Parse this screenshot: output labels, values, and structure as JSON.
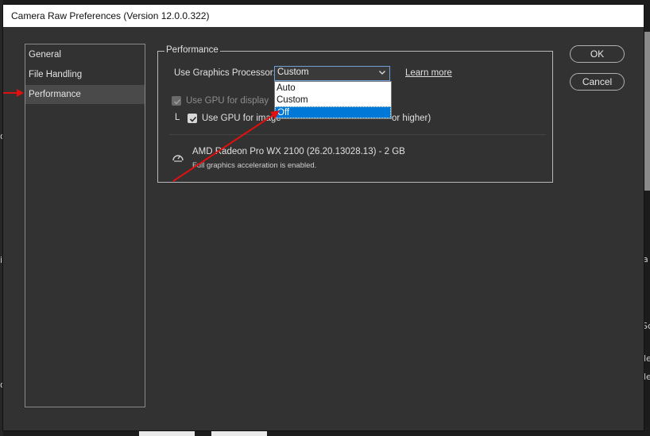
{
  "dialog": {
    "title": "Camera Raw Preferences  (Version 12.0.0.322)"
  },
  "sidebar": {
    "items": [
      {
        "label": "General"
      },
      {
        "label": "File Handling"
      },
      {
        "label": "Performance"
      }
    ]
  },
  "performance": {
    "group_title": "Performance",
    "gpu_label": "Use Graphics Processor:",
    "gpu_selected": "Custom",
    "gpu_options": [
      "Auto",
      "Custom",
      "Off"
    ],
    "gpu_highlighted": "Off",
    "learn_more": "Learn more",
    "display_label": "Use GPU for display",
    "image_label": "Use GPU for image",
    "image_label_suffix": "or higher)",
    "tree_marker": "L",
    "gpu_name": "AMD Radeon Pro WX 2100 (26.20.13028.13) - 2 GB",
    "gpu_status": "Full graphics acceleration is enabled."
  },
  "buttons": {
    "ok": "OK",
    "cancel": "Cancel"
  },
  "background": {
    "fragments": [
      "or",
      "i",
      "Sc",
      "le",
      "le",
      "a",
      "o"
    ]
  },
  "colors": {
    "arrow": "#e01010",
    "selection": "#0078d7"
  },
  "icons": {
    "select": "chevron-down-icon",
    "gpu": "gauge-icon",
    "annotation": "arrow"
  }
}
